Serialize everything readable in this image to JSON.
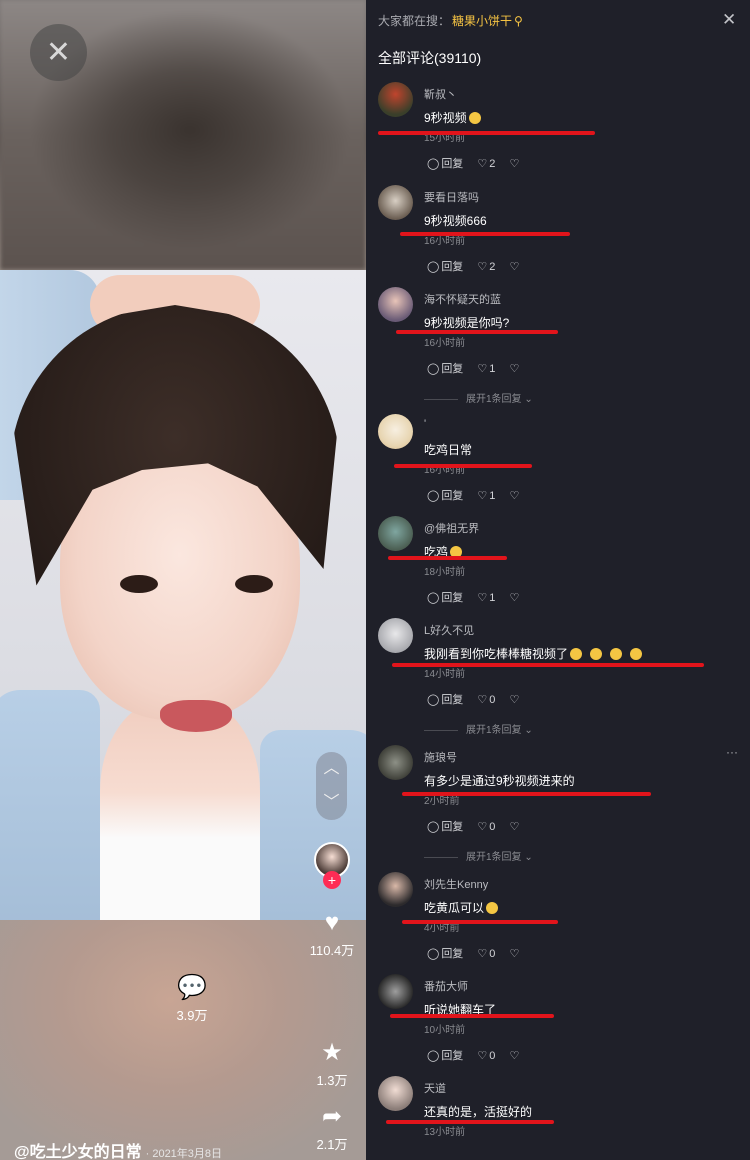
{
  "video": {
    "close_icon": "close-icon",
    "actions": {
      "like_count": "110.4万",
      "comment_count": "3.9万",
      "favorite_count": "1.3万",
      "share_count": "2.1万"
    },
    "author_handle": "@吃土少女的日常",
    "post_date": "· 2021年3月8日"
  },
  "panel": {
    "search_prefix": "大家都在搜：",
    "search_keyword": "糖果小饼干",
    "search_icon": "search-icon",
    "total_label": "全部评论(39110)"
  },
  "comments": [
    {
      "user": "靳叔丶",
      "text": "9秒视频",
      "emoji": true,
      "time": "15小时前",
      "likes": "2",
      "expand": ""
    },
    {
      "user": "要看日落吗",
      "text": "9秒视频666",
      "emoji": false,
      "time": "16小时前",
      "likes": "2",
      "expand": ""
    },
    {
      "user": "海不怀疑天的蓝",
      "text": "9秒视频是你吗?",
      "emoji": false,
      "time": "16小时前",
      "likes": "1",
      "expand": "展开1条回复"
    },
    {
      "user": "'",
      "text": "吃鸡日常",
      "emoji": false,
      "time": "16小时前",
      "likes": "1",
      "expand": ""
    },
    {
      "user": "@佛祖无界",
      "text": "吃鸡",
      "emoji": true,
      "time": "18小时前",
      "likes": "1",
      "expand": ""
    },
    {
      "user": "L好久不见",
      "text": "我刚看到你吃棒棒糖视频了",
      "emoji": true,
      "time": "14小时前",
      "likes": "0",
      "expand": "展开1条回复"
    },
    {
      "user": "施琅号",
      "text": "有多少是通过9秒视频进来的",
      "emoji": false,
      "time": "2小时前",
      "likes": "0",
      "expand": "展开1条回复"
    },
    {
      "user": "刘先生Kenny",
      "text": "吃黄瓜可以",
      "emoji": true,
      "time": "4小时前",
      "likes": "0",
      "expand": ""
    },
    {
      "user": "番茄大师",
      "text": "听说她翻车了",
      "emoji": false,
      "time": "10小时前",
      "likes": "0",
      "expand": ""
    },
    {
      "user": "天道",
      "text": "还真的是，活挺好的",
      "emoji": false,
      "time": "13小时前",
      "likes": "",
      "expand": ""
    }
  ],
  "labels": {
    "reply": "回复"
  },
  "colors": {
    "panel_bg": "#1f2029",
    "accent_keyword": "#f5c343",
    "annotation_red": "#e1141b",
    "follow_badge": "#fe2c55"
  }
}
